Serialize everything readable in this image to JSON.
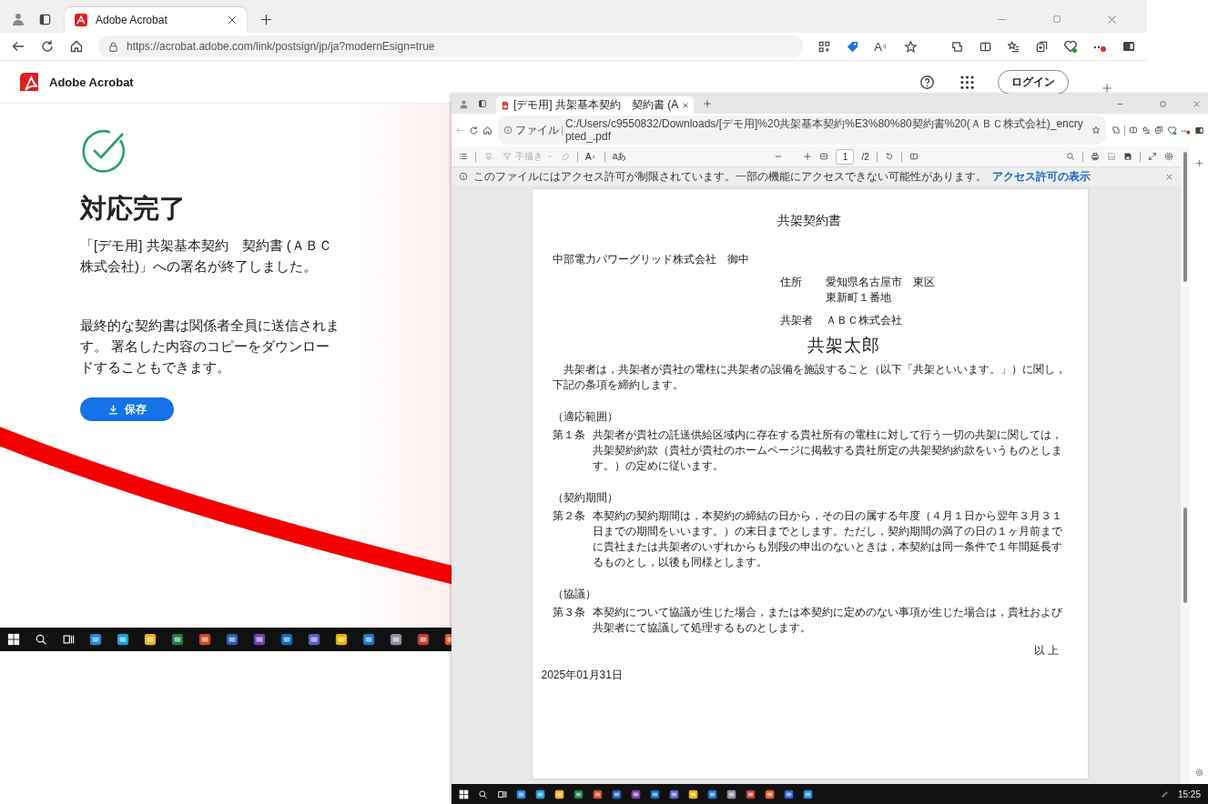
{
  "back_window": {
    "tab": {
      "title": "Adobe Acrobat",
      "selected": true
    },
    "url": "https://acrobat.adobe.com/link/postsign/jp/ja?modernEsign=true",
    "read_aloud_glyph": "A",
    "app_name": "Adobe Acrobat",
    "login_button": "ログイン",
    "heading": "対応完了",
    "message": "「[デモ用] 共架基本契約　契約書 (ＡＢＣ株式会社)」への署名が終了しました。",
    "note": "最終的な契約書は関係者全員に送信されます。 署名した内容のコピーをダウンロードすることもできます。",
    "save_button": "保存"
  },
  "front_window": {
    "tab": {
      "title": "[デモ用] 共架基本契約　契約書 (A",
      "selected": true
    },
    "address_scheme": "ファイル",
    "url": "C:/Users/c9550832/Downloads/[デモ用]%20共架基本契約%E3%80%80契約書%20(ＡＢＣ株式会社)_encrypted_.pdf",
    "toolbar": {
      "draw_label": "手描き",
      "draw_disabled": true,
      "read_aloud_glyph": "A",
      "text_glyph": "aあ",
      "page_number": "1",
      "page_total": "/2"
    },
    "notice": {
      "text": "このファイルにはアクセス許可が制限されています。一部の機能にアクセスできない可能性があります。",
      "link": "アクセス許可の表示"
    },
    "document": {
      "title": "共架契約書",
      "addressee": "中部電力パワーグリッド株式会社　御中",
      "address_label": "住所",
      "address_lines": [
        "愛知県名古屋市　東区",
        "東新町１番地"
      ],
      "party_label": "共架者",
      "party_name": "ＡＢＣ株式会社",
      "signature": "共架太郎",
      "intro": "共架者は，共架者が貴社の電柱に共架者の設備を施設すること（以下「共架といいます。」）に関し，下記の条項を締約します。",
      "articles": [
        {
          "heading": "（適応範囲）",
          "number": "第１条",
          "text": "共架者が貴社の託送供給区域内に存在する貴社所有の電柱に対して行う一切の共架に関しては，共架契約約款（貴社が貴社のホームページに掲載する貴社所定の共架契約約款をいうものとします。）の定めに従います。"
        },
        {
          "heading": "（契約期間）",
          "number": "第２条",
          "text": "本契約の契約期間は，本契約の締結の日から，その日の属する年度（４月１日から翌年３月３１日までの期間をいいます。）の末日までとします。ただし，契約期間の満了の日の１ヶ月前までに貴社または共架者のいずれからも別段の申出のないときは，本契約は同一条件で１年間延長するものとし，以後も同様とします。"
        },
        {
          "heading": "（協議）",
          "number": "第３条",
          "text": "本契約について協議が生じた場合，または本契約に定めのない事項が生じた場合は，貴社および共架者にて協議して処理するものとします。"
        }
      ],
      "closing": "以 上",
      "date": "2025年01月31日"
    },
    "clock": "15:25"
  }
}
